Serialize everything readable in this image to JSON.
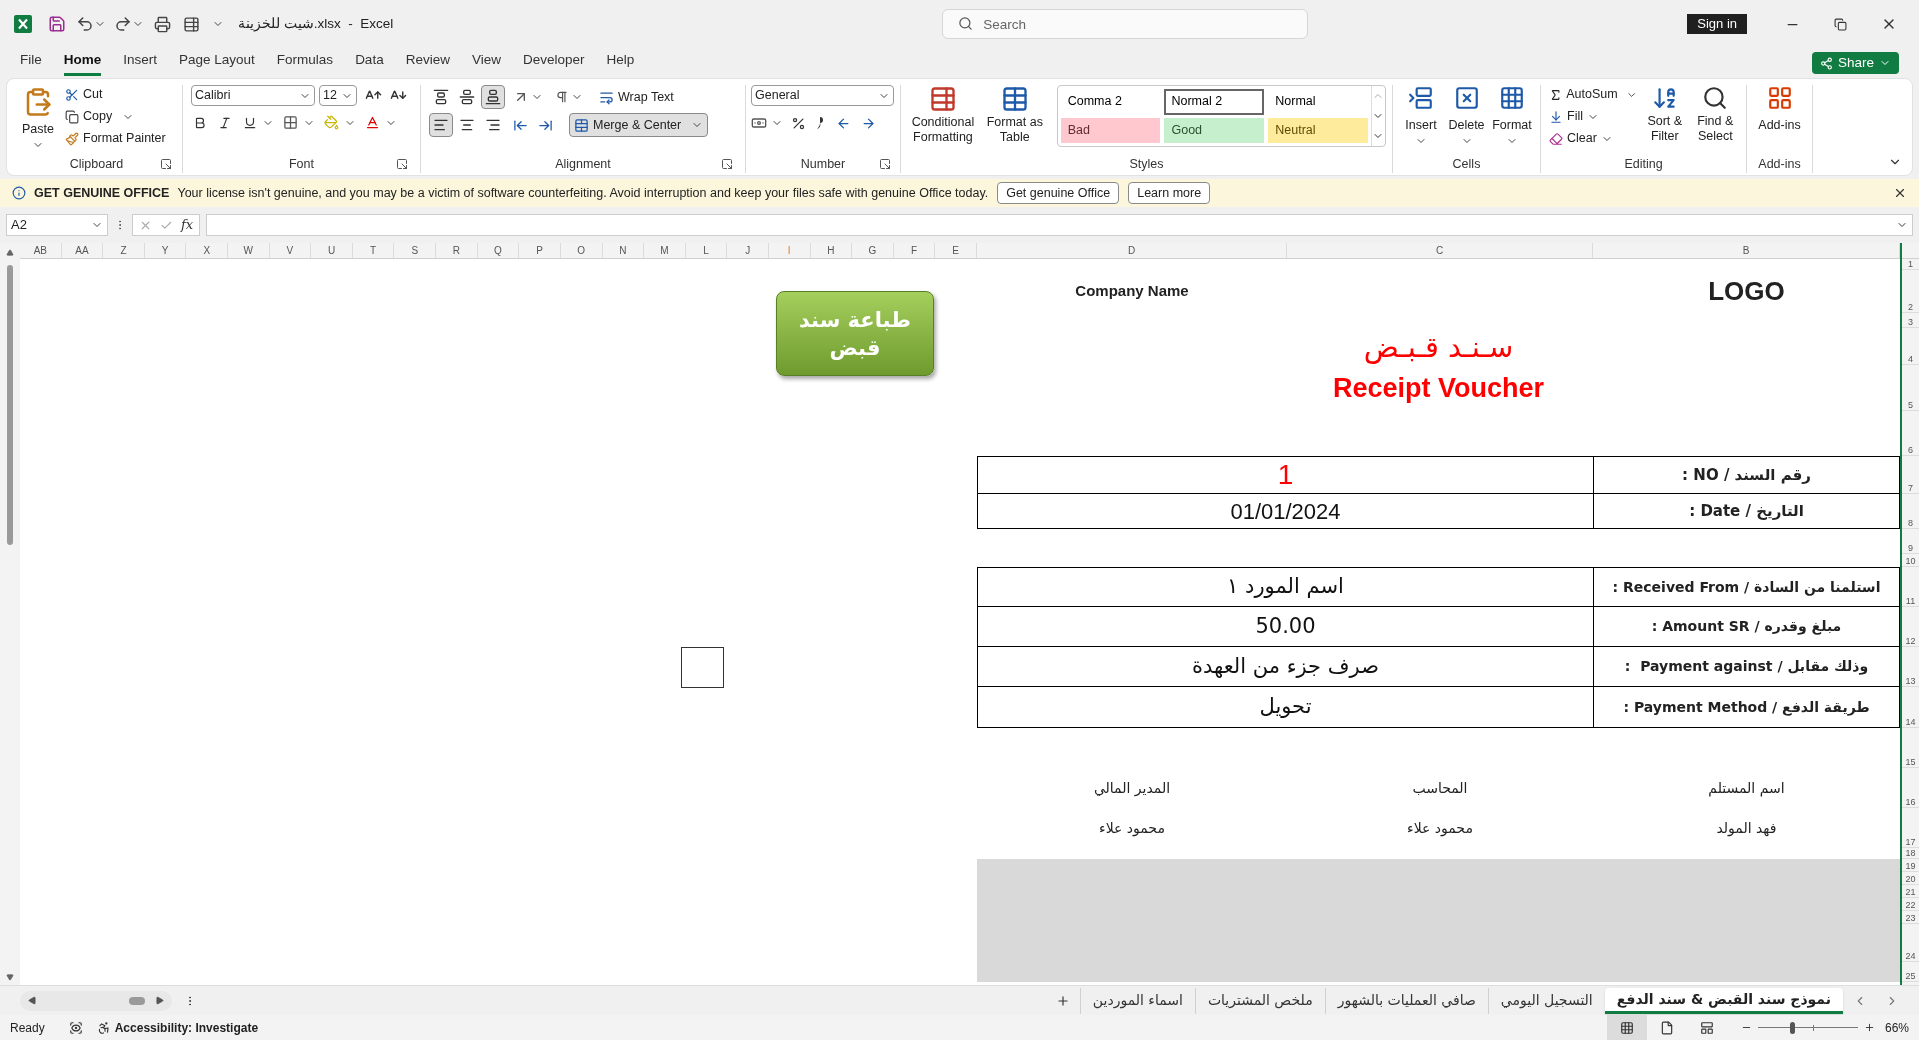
{
  "title_bar": {
    "file_name": "شيت للخزينة.xlsx  -  Excel",
    "search_placeholder": "Search",
    "sign_in": "Sign in"
  },
  "menu_tabs": [
    {
      "label": "File",
      "selected": false
    },
    {
      "label": "Home",
      "selected": true
    },
    {
      "label": "Insert",
      "selected": false
    },
    {
      "label": "Page Layout",
      "selected": false
    },
    {
      "label": "Formulas",
      "selected": false
    },
    {
      "label": "Data",
      "selected": false
    },
    {
      "label": "Review",
      "selected": false
    },
    {
      "label": "View",
      "selected": false
    },
    {
      "label": "Developer",
      "selected": false
    },
    {
      "label": "Help",
      "selected": false
    }
  ],
  "share": "Share",
  "ribbon": {
    "clipboard": {
      "label": "Clipboard",
      "paste": "Paste",
      "cut": "Cut",
      "copy": "Copy",
      "format_painter": "Format Painter"
    },
    "font": {
      "label": "Font",
      "font_name": "Calibri",
      "font_size": "12"
    },
    "alignment": {
      "label": "Alignment",
      "wrap_text": "Wrap Text",
      "merge": "Merge & Center",
      "merge_pressed": true,
      "vertical": [
        {
          "kind": "top",
          "pressed": false
        },
        {
          "kind": "middle",
          "pressed": false
        },
        {
          "kind": "bottom",
          "pressed": true
        }
      ],
      "horizontal": [
        {
          "kind": "left",
          "pressed": true
        },
        {
          "kind": "center",
          "pressed": false
        },
        {
          "kind": "right",
          "pressed": false
        }
      ]
    },
    "number": {
      "label": "Number",
      "format": "General"
    },
    "styles": {
      "label": "Styles",
      "conditional": "Conditional Formatting",
      "format_table": "Format as Table",
      "gallery": [
        {
          "name": "Comma 2",
          "color": "#ffffff",
          "selected": false
        },
        {
          "name": "Normal 2",
          "color": "#ffffff",
          "selected": true
        },
        {
          "name": "Normal",
          "color": "#ffffff",
          "selected": false
        },
        {
          "name": "Bad",
          "color": "#ffc7ce",
          "selected": false
        },
        {
          "name": "Good",
          "color": "#c6efce",
          "selected": false
        },
        {
          "name": "Neutral",
          "color": "#ffeb9c",
          "selected": false
        }
      ]
    },
    "cells": {
      "label": "Cells",
      "insert": "Insert",
      "delete": "Delete",
      "format": "Format"
    },
    "editing": {
      "label": "Editing",
      "autosum": "AutoSum",
      "fill": "Fill",
      "clear": "Clear",
      "sort": "Sort & Filter",
      "find": "Find & Select"
    },
    "addins": {
      "label": "Add-ins",
      "button": "Add-ins"
    }
  },
  "message_bar": {
    "title": "GET GENUINE OFFICE",
    "text": "Your license isn't genuine, and you may be a victim of software counterfeiting. Avoid interruption and keep your files safe with genuine Office today.",
    "buttons": [
      "Get genuine Office",
      "Learn more"
    ]
  },
  "formula_bar": {
    "name_box": "A2",
    "function_label": "fx"
  },
  "sheet": {
    "columns": [
      {
        "label": "AB",
        "selected": false
      },
      {
        "label": "AA",
        "selected": false
      },
      {
        "label": "Z",
        "selected": false
      },
      {
        "label": "Y",
        "selected": false
      },
      {
        "label": "X",
        "selected": false
      },
      {
        "label": "W",
        "selected": false
      },
      {
        "label": "V",
        "selected": false
      },
      {
        "label": "U",
        "selected": false
      },
      {
        "label": "T",
        "selected": false
      },
      {
        "label": "S",
        "selected": false
      },
      {
        "label": "R",
        "selected": false
      },
      {
        "label": "Q",
        "selected": false
      },
      {
        "label": "P",
        "selected": false
      },
      {
        "label": "O",
        "selected": false
      },
      {
        "label": "N",
        "selected": false
      },
      {
        "label": "M",
        "selected": false
      },
      {
        "label": "L",
        "selected": false
      },
      {
        "label": "J",
        "selected": false
      },
      {
        "label": "I",
        "selected": true
      },
      {
        "label": "H",
        "selected": false
      },
      {
        "label": "G",
        "selected": false
      },
      {
        "label": "F",
        "selected": false
      },
      {
        "label": "E",
        "selected": false
      },
      {
        "label": "D",
        "selected": false
      },
      {
        "label": "C",
        "selected": false
      },
      {
        "label": "B",
        "selected": false
      }
    ],
    "rows": [
      "1",
      "2",
      "3",
      "4",
      "5",
      "6",
      "7",
      "8",
      "9",
      "10",
      "11",
      "12",
      "13",
      "14",
      "15",
      "16",
      "17",
      "18",
      "19",
      "20",
      "21",
      "22",
      "23",
      "24",
      "25"
    ],
    "print_button": "طباعة سند قبض",
    "company_name": "Company Name",
    "logo": "LOGO",
    "title_ar": "سـنـد قـبـض",
    "title_en": "Receipt Voucher",
    "header_fields": [
      {
        "kind": "voucher_no",
        "label": "رقم السند / NO :",
        "value": "1"
      },
      {
        "kind": "plain",
        "label": "التاريخ / Date :",
        "value": "01/01/2024"
      }
    ],
    "detail_fields": [
      {
        "label": "استلمنا من السادة / Received From :",
        "value": "اسم المورد ١"
      },
      {
        "label": "مبلغ وقدره / Amount SR :",
        "value": "50.00"
      },
      {
        "label": "وذلك مقابل / Payment against  :",
        "value": "صرف جزء من العهدة"
      },
      {
        "label": "طريقة الدفع / Payment Method :",
        "value": "تحويل"
      }
    ],
    "signatures": [
      {
        "title": "اسم المستلم",
        "name": "فهد المولد"
      },
      {
        "title": "المحاسب",
        "name": "محمود علاء"
      },
      {
        "title": "المدير المالي",
        "name": "محمود علاء"
      }
    ]
  },
  "sheet_tabs": [
    {
      "label": "نموذج سند القبض & سند الدفع",
      "selected": true
    },
    {
      "label": "التسجيل اليومي",
      "selected": false
    },
    {
      "label": "صافي العمليات بالشهور",
      "selected": false
    },
    {
      "label": "ملخص المشتريات",
      "selected": false
    },
    {
      "label": "اسماء الموردين",
      "selected": false
    }
  ],
  "status_bar": {
    "ready": "Ready",
    "accessibility": "Accessibility: Investigate",
    "views": [
      {
        "kind": "normal",
        "selected": true
      },
      {
        "kind": "page_layout",
        "selected": false
      },
      {
        "kind": "page_break",
        "selected": false
      }
    ],
    "zoom": {
      "level": 0.34,
      "reading": "66%"
    }
  }
}
